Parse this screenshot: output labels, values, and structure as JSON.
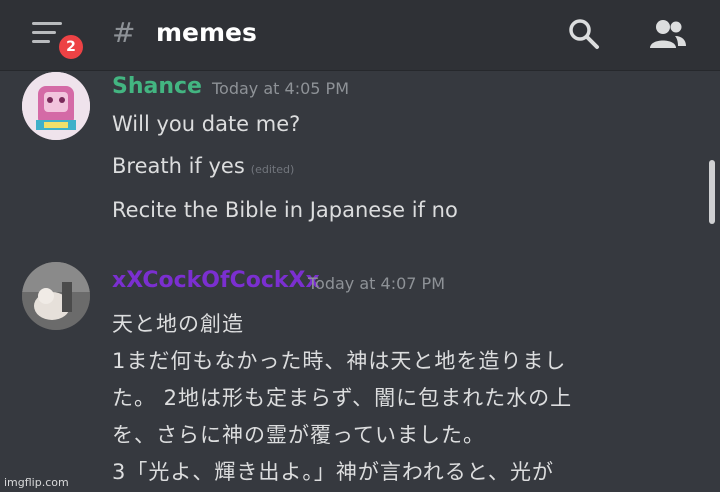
{
  "header": {
    "badge_count": "2",
    "channel_name": "memes",
    "hash_symbol": "#"
  },
  "messages": [
    {
      "username": "Shance",
      "username_color": "#43b581",
      "timestamp": "Today at 4:05 PM",
      "lines": [
        "Will you date me?",
        "Breath if yes",
        "Recite the Bible in Japanese if no"
      ],
      "edited_label": "(edited)"
    },
    {
      "username": "xXCockOfCockXx",
      "username_color": "#7b2fd0",
      "timestamp": "Today at 4:07 PM",
      "lines": [
        "天と地の創造",
        "1まだ何もなかった時、神は天と地を造りまし",
        "た。 2地は形も定まらず、闇に包まれた水の上",
        "を、さらに神の霊が覆っていました。",
        "3「光よ、輝き出よ。」神が言われると、光が"
      ]
    }
  ],
  "watermark": "imgflip.com",
  "colors": {
    "background": "#36393f",
    "header_background": "#2f3136",
    "badge": "#ed4245"
  }
}
